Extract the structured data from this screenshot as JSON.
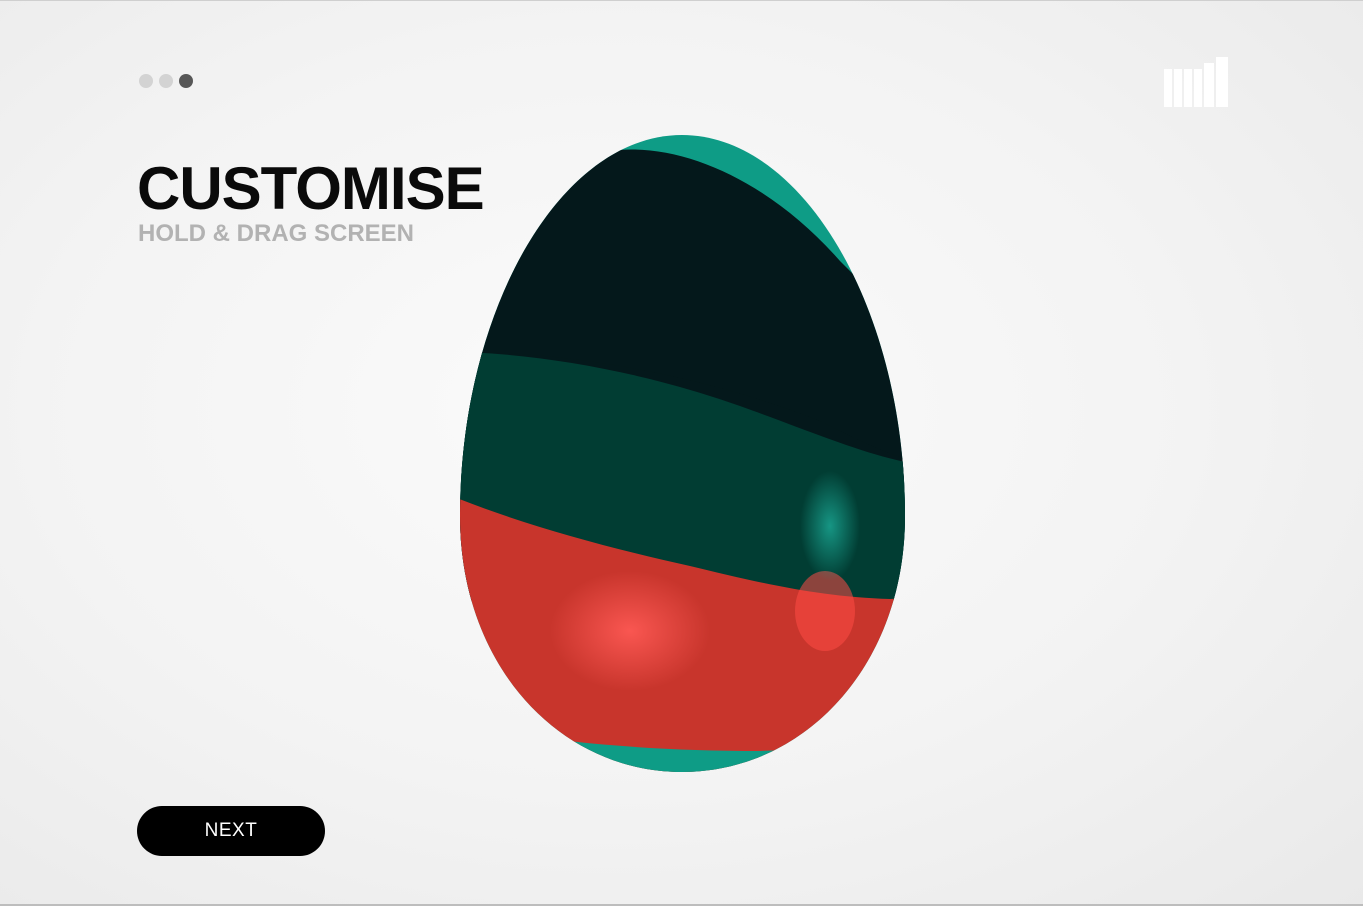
{
  "progress": {
    "total_steps": 3,
    "current_step": 3
  },
  "header": {
    "title": "CUSTOMISE",
    "subtitle": "HOLD & DRAG SCREEN"
  },
  "brand": {
    "logo_icon": "bar-chart-logo-icon"
  },
  "egg": {
    "bands": [
      {
        "name": "top-cap",
        "color": "#0e9c86"
      },
      {
        "name": "upper",
        "color": "#04181b"
      },
      {
        "name": "middle",
        "color": "#013d33"
      },
      {
        "name": "lower",
        "color": "#c8352c"
      },
      {
        "name": "bottom-cap",
        "color": "#0e9c86"
      }
    ]
  },
  "actions": {
    "next_label": "NEXT"
  },
  "colors": {
    "accent_dark": "#000000",
    "dot_inactive": "#d3d3d3",
    "dot_active": "#575757",
    "subtitle": "#b2b2b2"
  }
}
